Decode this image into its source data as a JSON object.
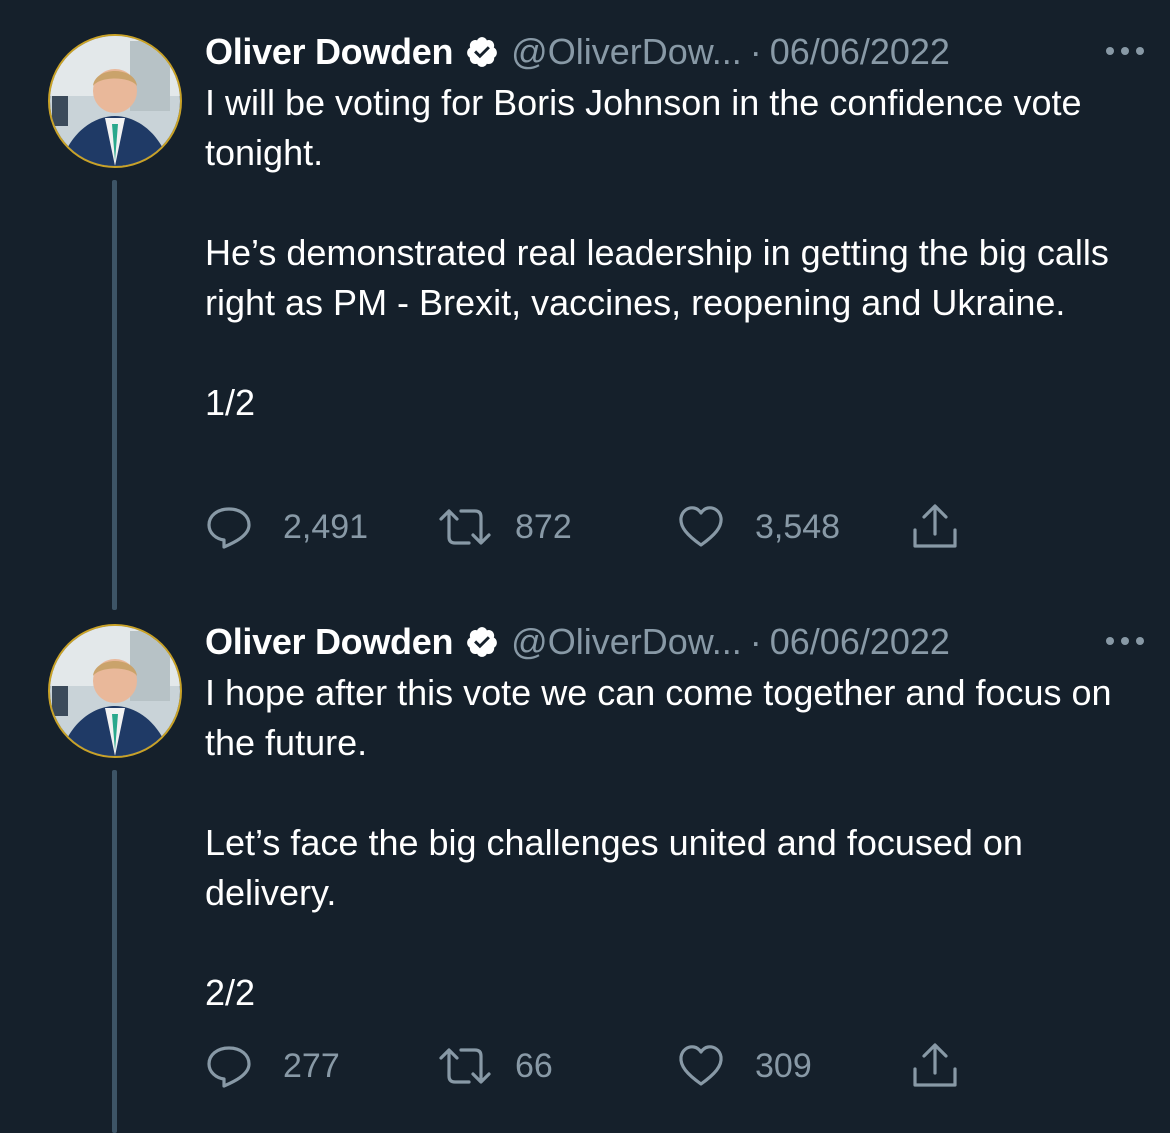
{
  "tweets": [
    {
      "author_name": "Oliver Dowden",
      "handle": "@OliverDow...",
      "separator": "·",
      "date": "06/06/2022",
      "text": "I will be voting for Boris Johnson in the confidence vote tonight.\n\nHe’s demonstrated real leadership in getting the big calls right as PM - Brexit, vaccines, reopening and Ukraine.\n\n1/2",
      "replies": "2,491",
      "retweets": "872",
      "likes": "3,548",
      "icons": {
        "verified": "verified-badge-icon",
        "more": "more-options-icon",
        "reply": "reply-icon",
        "retweet": "retweet-icon",
        "like": "heart-icon",
        "share": "share-icon"
      }
    },
    {
      "author_name": "Oliver Dowden",
      "handle": "@OliverDow...",
      "separator": "·",
      "date": "06/06/2022",
      "text": "I hope after this vote we can come together and focus on the future.\n\nLet’s face the big challenges united and focused on delivery.\n\n2/2",
      "replies": "277",
      "retweets": "66",
      "likes": "309",
      "icons": {
        "verified": "verified-badge-icon",
        "more": "more-options-icon",
        "reply": "reply-icon",
        "retweet": "retweet-icon",
        "like": "heart-icon",
        "share": "share-icon"
      }
    }
  ],
  "colors": {
    "background": "#15202b",
    "primary_text": "#ffffff",
    "secondary_text": "#8899a6",
    "thread_line": "#3d5466",
    "verified_badge": "#ffffff"
  }
}
